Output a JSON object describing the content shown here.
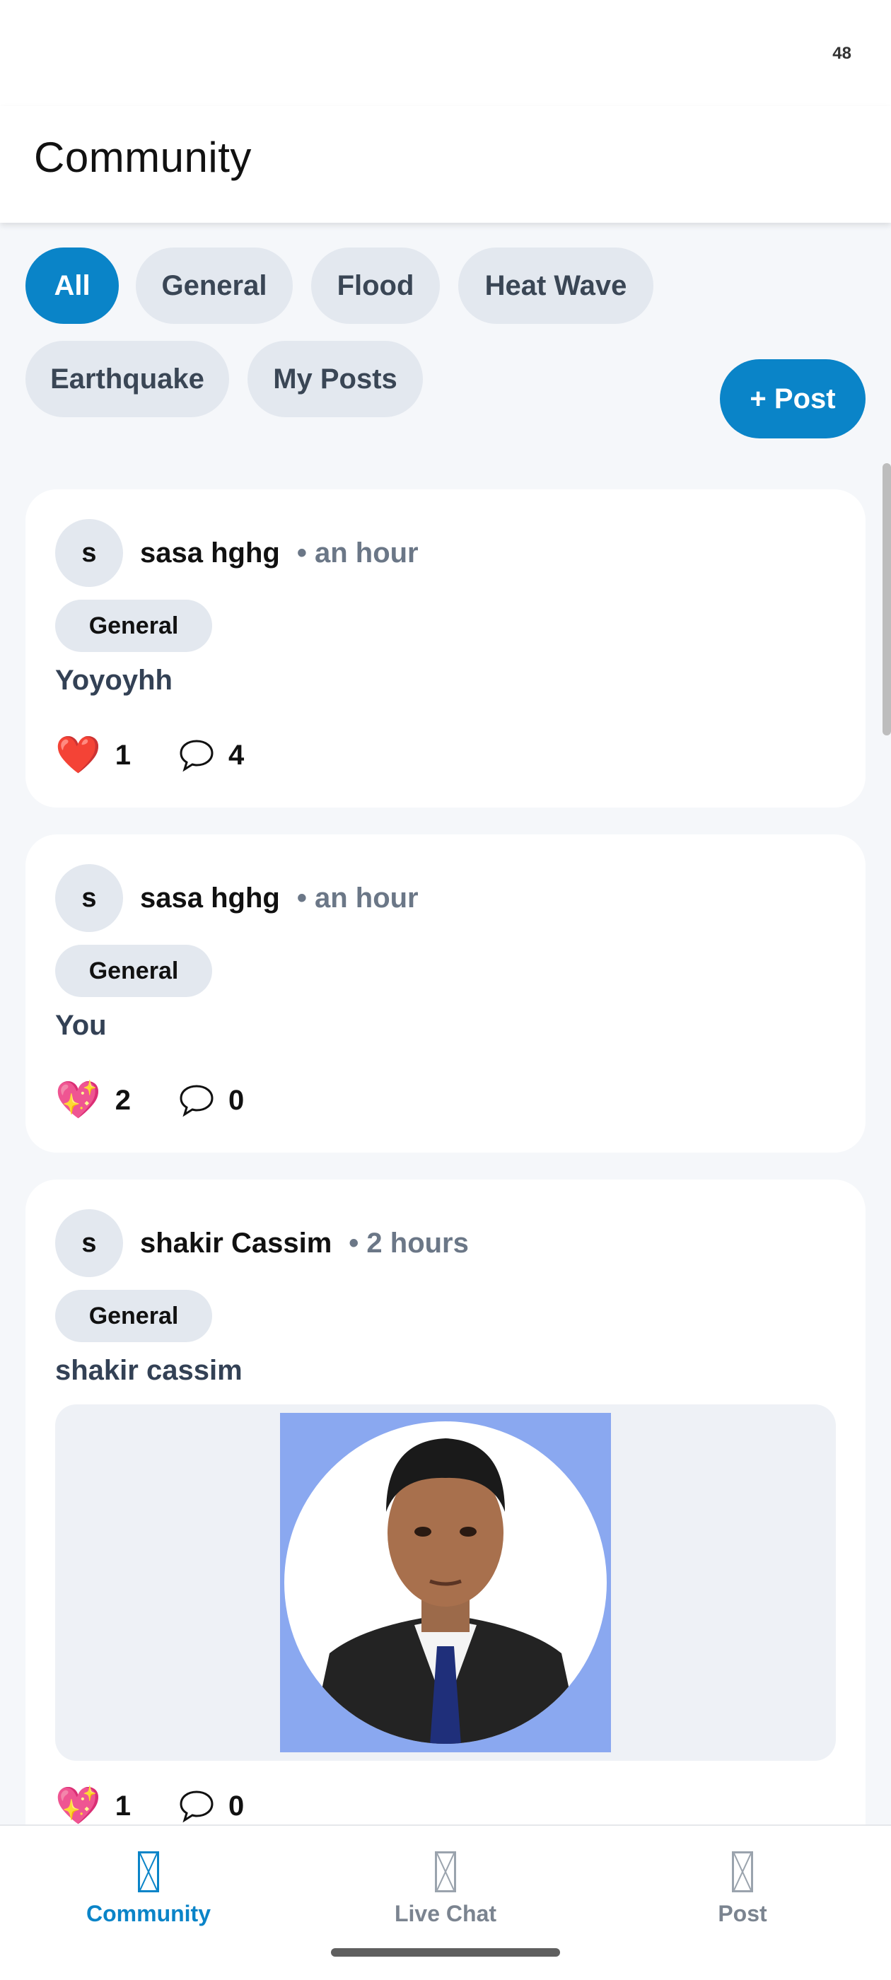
{
  "status_bar": {
    "number": "48"
  },
  "header": {
    "title": "Community"
  },
  "filters": [
    {
      "label": "All",
      "active": true
    },
    {
      "label": "General",
      "active": false
    },
    {
      "label": "Flood",
      "active": false
    },
    {
      "label": "Heat Wave",
      "active": false
    },
    {
      "label": "Earthquake",
      "active": false
    },
    {
      "label": "My Posts",
      "active": false
    }
  ],
  "new_post_button": "+ Post",
  "posts": [
    {
      "avatar": "s",
      "author": "sasa hghg",
      "time": "• an hour",
      "tag": "General",
      "text": "Yoyoyhh",
      "reaction_emoji": "❤️",
      "reactions": "1",
      "comments": "4"
    },
    {
      "avatar": "s",
      "author": "sasa hghg",
      "time": "• an hour",
      "tag": "General",
      "text": "You",
      "reaction_emoji": "💖",
      "reactions": "2",
      "comments": "0"
    },
    {
      "avatar": "s",
      "author": "shakir Cassim",
      "time": "• 2 hours",
      "tag": "General",
      "text": "shakir cassim",
      "reaction_emoji": "💖",
      "reactions": "1",
      "comments": "0"
    }
  ],
  "bottom_nav": [
    {
      "label": "Community",
      "icon": "missing-glyph-icon",
      "active": true
    },
    {
      "label": "Live Chat",
      "icon": "missing-glyph-icon",
      "active": false
    },
    {
      "label": "Post",
      "icon": "missing-glyph-icon",
      "active": false
    }
  ],
  "colors": {
    "accent": "#0a84c8",
    "chip": "#e3e8ef",
    "muted": "#6b7787"
  }
}
